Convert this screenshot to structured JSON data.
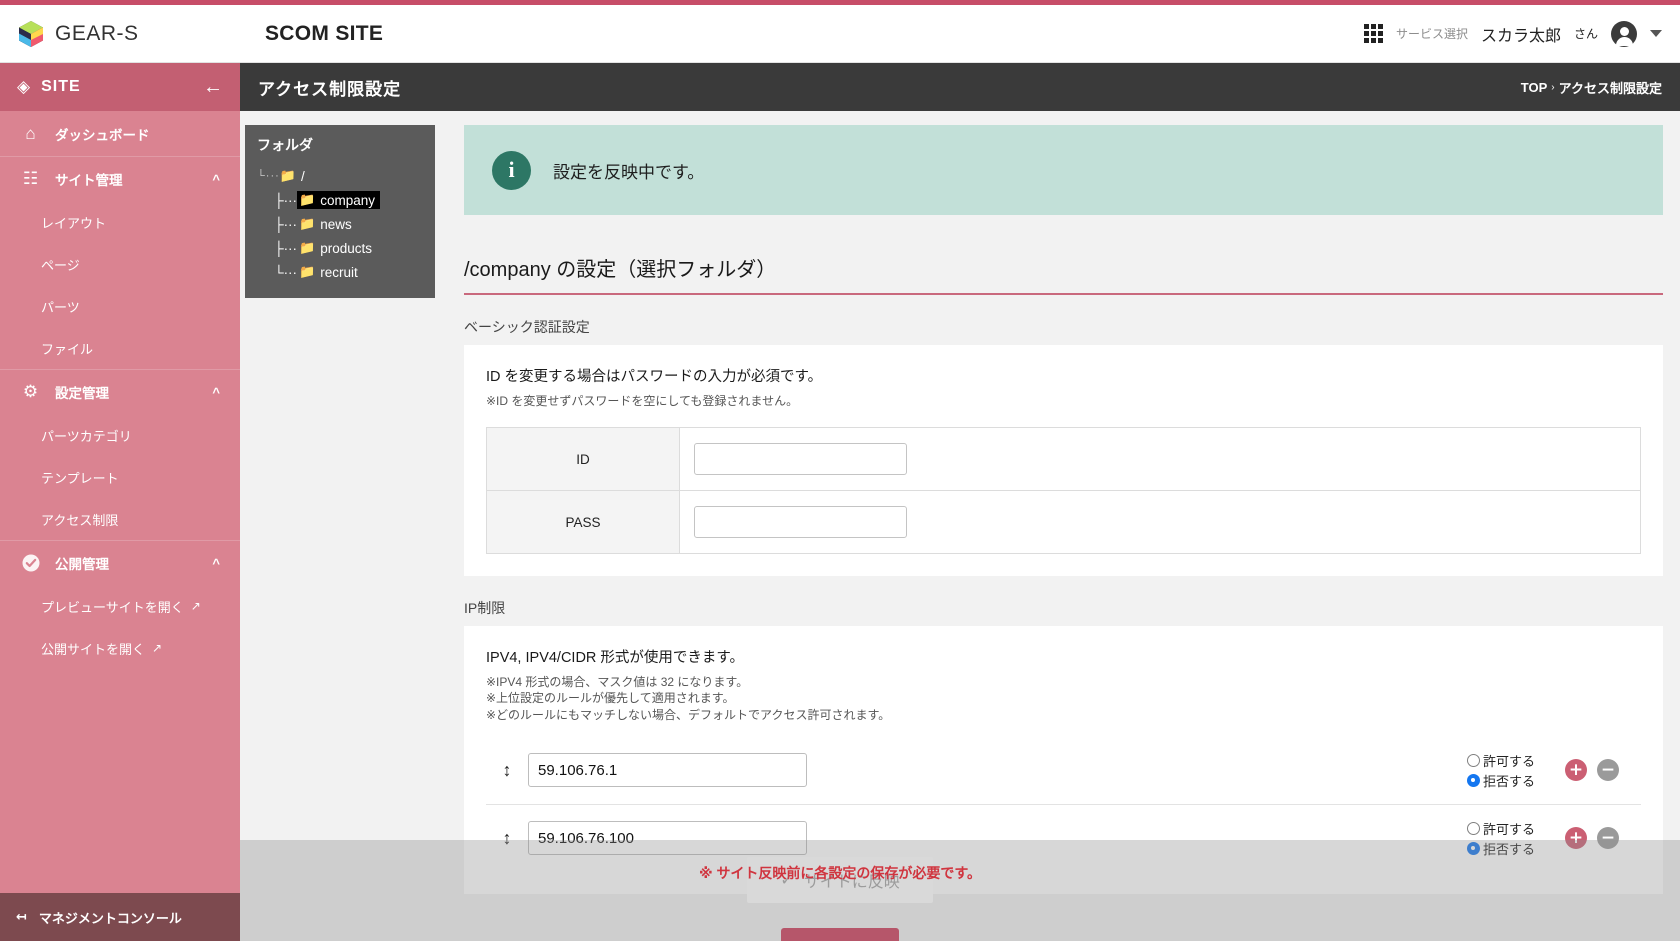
{
  "header": {
    "brand": "GEAR-S",
    "brand_logo_icon": "cube-logo-icon",
    "site_name": "SCOM SITE",
    "service_select_label": "サービス選択",
    "service_grid_icon": "grid-apps-icon",
    "user_name": "スカラ太郎",
    "user_suffix": "さん",
    "avatar_icon": "user-avatar-icon",
    "chevron_icon": "chevron-down-icon"
  },
  "sidebar": {
    "title": "SITE",
    "title_icon": "cube-site-icon",
    "collapse_icon": "arrow-left-icon",
    "groups": [
      {
        "label": "ダッシュボード",
        "icon": "home-icon",
        "caret": "",
        "items": []
      },
      {
        "label": "サイト管理",
        "icon": "sitemap-icon",
        "caret": "chevron-up-icon",
        "items": [
          {
            "label": "レイアウト",
            "ext": ""
          },
          {
            "label": "ページ",
            "ext": ""
          },
          {
            "label": "パーツ",
            "ext": ""
          },
          {
            "label": "ファイル",
            "ext": ""
          }
        ]
      },
      {
        "label": "設定管理",
        "icon": "gear-icon",
        "caret": "chevron-up-icon",
        "items": [
          {
            "label": "パーツカテゴリ",
            "ext": ""
          },
          {
            "label": "テンプレート",
            "ext": ""
          },
          {
            "label": "アクセス制限",
            "ext": ""
          }
        ]
      },
      {
        "label": "公開管理",
        "icon": "check-circle-icon",
        "caret": "chevron-up-icon",
        "items": [
          {
            "label": "プレビューサイトを開く",
            "ext": "external-link-icon"
          },
          {
            "label": "公開サイトを開く",
            "ext": "external-link-icon"
          }
        ]
      }
    ],
    "footer": {
      "label": "マネジメントコンソール",
      "icon": "exit-left-icon"
    }
  },
  "page": {
    "title": "アクセス制限設定",
    "breadcrumb_root": "TOP",
    "breadcrumb_sep": "›",
    "breadcrumb_current": "アクセス制限設定"
  },
  "tree": {
    "caption": "フォルダ",
    "root": "/",
    "root_icon": "folder-icon",
    "children": [
      {
        "label": "company",
        "icon": "folder-icon",
        "selected": true
      },
      {
        "label": "news",
        "icon": "folder-icon",
        "selected": false
      },
      {
        "label": "products",
        "icon": "folder-icon",
        "selected": false
      },
      {
        "label": "recruit",
        "icon": "folder-icon",
        "selected": false
      }
    ]
  },
  "alert": {
    "icon": "info-icon",
    "glyph": "i",
    "message": "設定を反映中です。",
    "bg_color": "#c2e0d8",
    "icon_color": "#2d7765"
  },
  "main": {
    "section_title": "/company の設定（選択フォルダ）",
    "accent_color": "#c9697d",
    "basic_auth": {
      "label": "ベーシック認証設定",
      "lead": "ID を変更する場合はパスワードの入力が必須です。",
      "note": "※ID を変更せずパスワードを空にしても登録されません。",
      "rows": [
        {
          "label": "ID",
          "value": "",
          "placeholder": ""
        },
        {
          "label": "PASS",
          "value": "",
          "placeholder": ""
        }
      ]
    },
    "ip_restriction": {
      "label": "IP制限",
      "lead": "IPV4, IPV4/CIDR 形式が使用できます。",
      "notes": [
        "※IPV4 形式の場合、マスク値は 32 になります。",
        "※上位設定のルールが優先して適用されます。",
        "※どのルールにもマッチしない場合、デフォルトでアクセス許可されます。"
      ],
      "radio_allow_label": "許可する",
      "radio_deny_label": "拒否する",
      "drag_icon": "drag-vertical-icon",
      "add_icon": "plus-circle-icon",
      "remove_icon": "minus-circle-icon",
      "rows": [
        {
          "value": "59.106.76.1",
          "mode": "deny"
        },
        {
          "value": "59.106.76.100",
          "mode": "deny"
        }
      ]
    }
  },
  "footer_actions": {
    "reflect_label": "サイトに反映",
    "reflect_icon": "check-icon",
    "reflect_disabled": true,
    "warning": "※ サイト反映前に各設定の保存が必要です。",
    "warning_color": "#d0353f"
  }
}
